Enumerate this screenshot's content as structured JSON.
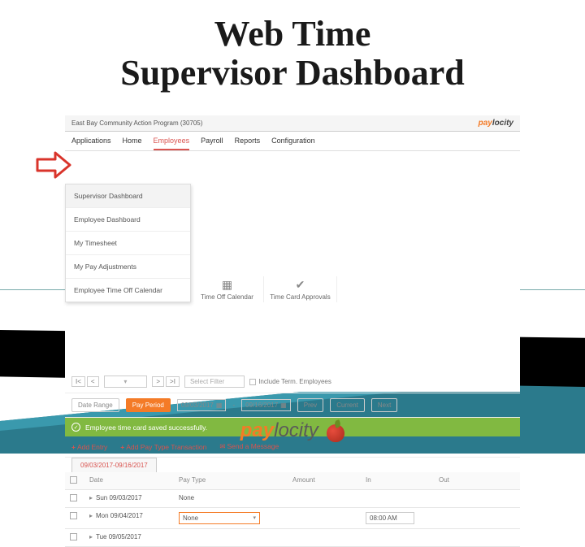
{
  "slide": {
    "title_line1": "Web Time",
    "title_line2": "Supervisor Dashboard"
  },
  "header": {
    "company": "East Bay Community Action Program (30705)",
    "brand_prefix": "pay",
    "brand_suffix": "locity"
  },
  "main_nav": {
    "applications": "Applications",
    "home": "Home",
    "employees": "Employees",
    "payroll": "Payroll",
    "reports": "Reports",
    "configuration": "Configuration"
  },
  "dropdown": {
    "supervisor_dashboard": "Supervisor Dashboard",
    "employee_dashboard": "Employee Dashboard",
    "my_timesheet": "My Timesheet",
    "my_pay_adjustments": "My Pay Adjustments",
    "employee_time_off_calendar": "Employee Time Off Calendar"
  },
  "subnav": {
    "time_off_calendar": "Time Off Calendar",
    "time_card_approvals": "Time Card Approvals"
  },
  "toolbar": {
    "first": "I<",
    "prev": "<",
    "next": ">",
    "last": ">I",
    "filter_placeholder": "Select Filter",
    "include_term": "Include Term. Employees"
  },
  "daterange": {
    "date_range_btn": "Date Range",
    "pay_period_btn": "Pay Period",
    "start": "09/03/2017",
    "end": "09/16/2017",
    "prev": "Prev",
    "current": "Current",
    "next": "Next"
  },
  "alert": {
    "success": "Employee time card saved successfully."
  },
  "actions": {
    "add_entry": "Add Entry",
    "add_paytype": "Add Pay Type Transaction",
    "send_message": "Send a Message"
  },
  "tabs": {
    "range": "09/03/2017-09/16/2017"
  },
  "grid": {
    "cols": {
      "date": "Date",
      "paytype": "Pay Type",
      "amount": "Amount",
      "in": "In",
      "out": "Out"
    },
    "rows": [
      {
        "date": "Sun 09/03/2017",
        "paytype": "None",
        "amount": "",
        "in": "",
        "out": ""
      },
      {
        "date": "Mon 09/04/2017",
        "paytype": "None",
        "amount": "",
        "in": "08:00 AM",
        "out": ""
      },
      {
        "date": "Tue 09/05/2017",
        "paytype": "",
        "amount": "",
        "in": "",
        "out": ""
      }
    ]
  },
  "footer": {
    "brand_prefix": "pay",
    "brand_suffix": "locity"
  }
}
